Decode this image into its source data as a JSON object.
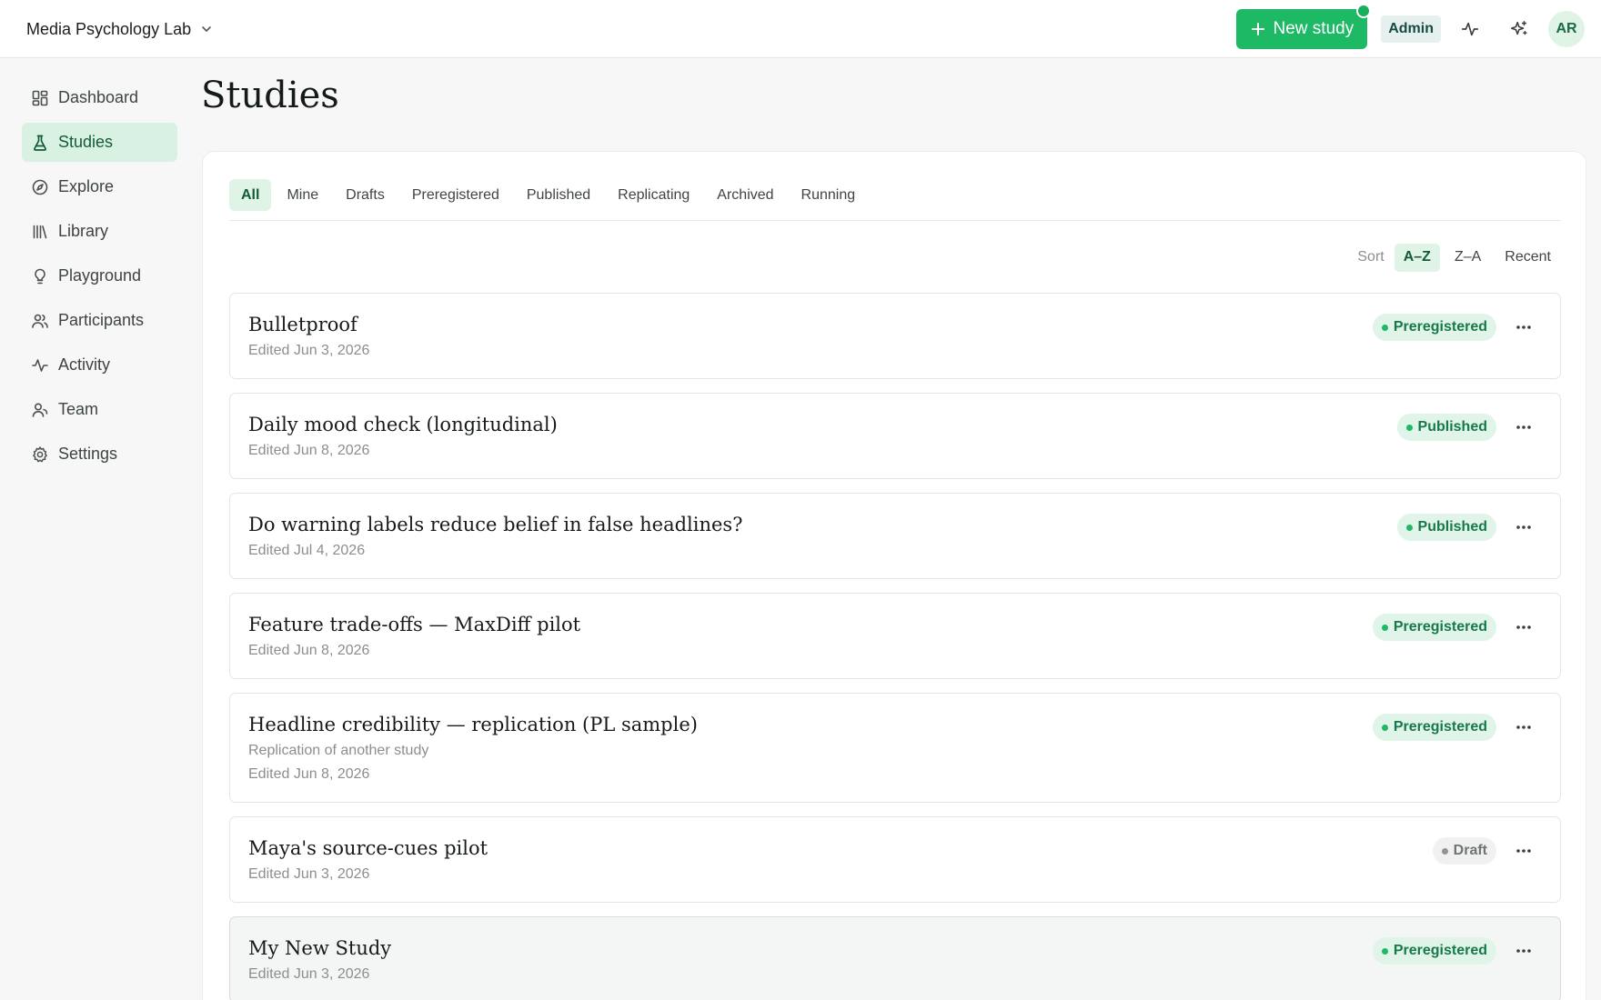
{
  "header": {
    "workspace": "Media Psychology Lab",
    "new_study_label": "New study",
    "role_badge": "Admin",
    "avatar_initials": "AR"
  },
  "sidebar": {
    "items": [
      {
        "label": "Dashboard",
        "icon": "dashboard-icon"
      },
      {
        "label": "Studies",
        "icon": "flask-icon",
        "active": true
      },
      {
        "label": "Explore",
        "icon": "compass-icon"
      },
      {
        "label": "Library",
        "icon": "library-icon"
      },
      {
        "label": "Playground",
        "icon": "lightbulb-icon"
      },
      {
        "label": "Participants",
        "icon": "users-icon"
      },
      {
        "label": "Activity",
        "icon": "activity-icon"
      },
      {
        "label": "Team",
        "icon": "team-icon"
      },
      {
        "label": "Settings",
        "icon": "gear-icon"
      }
    ]
  },
  "main": {
    "title": "Studies",
    "tabs": [
      "All",
      "Mine",
      "Drafts",
      "Preregistered",
      "Published",
      "Replicating",
      "Archived",
      "Running"
    ],
    "active_tab": "All",
    "sort": {
      "label": "Sort",
      "options": [
        "A–Z",
        "Z–A",
        "Recent"
      ],
      "active": "A–Z"
    },
    "studies": [
      {
        "title": "Bulletproof",
        "edited": "Edited Jun 3, 2026",
        "status": "Preregistered",
        "status_color": "#1db964"
      },
      {
        "title": "Daily mood check (longitudinal)",
        "edited": "Edited Jun 8, 2026",
        "status": "Published",
        "status_color": "#1db964"
      },
      {
        "title": "Do warning labels reduce belief in false headlines?",
        "edited": "Edited Jul 4, 2026",
        "status": "Published",
        "status_color": "#1db964"
      },
      {
        "title": "Feature trade-offs — MaxDiff pilot",
        "edited": "Edited Jun 8, 2026",
        "status": "Preregistered",
        "status_color": "#1db964"
      },
      {
        "title": "Headline credibility — replication (PL sample)",
        "subtitle": "Replication of another study",
        "edited": "Edited Jun 8, 2026",
        "status": "Preregistered",
        "status_color": "#1db964"
      },
      {
        "title": "Maya's source-cues pilot",
        "edited": "Edited Jun 3, 2026",
        "status": "Draft",
        "status_color": "#8f9591"
      },
      {
        "title": "My New Study",
        "edited": "Edited Jun 3, 2026",
        "status": "Preregistered",
        "status_color": "#1db964"
      }
    ]
  },
  "colors": {
    "accent": "#1db964",
    "active_bg": "#dff3e7",
    "active_text": "#135b37"
  }
}
